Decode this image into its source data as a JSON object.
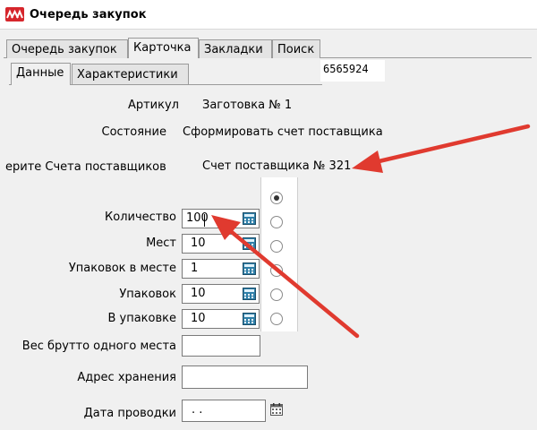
{
  "window": {
    "title": "Очередь закупок"
  },
  "tabs": [
    {
      "label": "Очередь закупок"
    },
    {
      "label": "Карточка"
    },
    {
      "label": "Закладки"
    },
    {
      "label": "Поиск"
    }
  ],
  "subtabs": [
    {
      "label": "Данные"
    },
    {
      "label": "Характеристики"
    }
  ],
  "record_id": "6565924",
  "form": {
    "article_label": "Артикул",
    "article_value": "Заготовка № 1",
    "state_label": "Состояние",
    "state_value": "Сформировать счет поставщика",
    "invoice_label": "ерите Счета поставщиков",
    "invoice_value": "Счет поставщика № 321",
    "quantity_label": "Количество",
    "quantity_value": "100",
    "places_label": "Мест",
    "places_value": "10",
    "packs_per_place_label": "Упаковок в месте",
    "packs_per_place_value": "1",
    "packs_label": "Упаковок",
    "packs_value": "10",
    "per_pack_label": "В упаковке",
    "per_pack_value": "10",
    "gross_weight_label": "Вес брутто одного места",
    "gross_weight_value": "",
    "storage_label": "Адрес хранения",
    "storage_value": "",
    "posting_date_label": "Дата проводки",
    "posting_date_value": " .  ."
  },
  "radio_selected_index": 0,
  "colors": {
    "arrow": "#e03a2f",
    "app_icon": "#d6262c"
  },
  "icons": {
    "app": "logo-icon",
    "calculator": "calculator-icon",
    "calendar": "calendar-icon"
  }
}
